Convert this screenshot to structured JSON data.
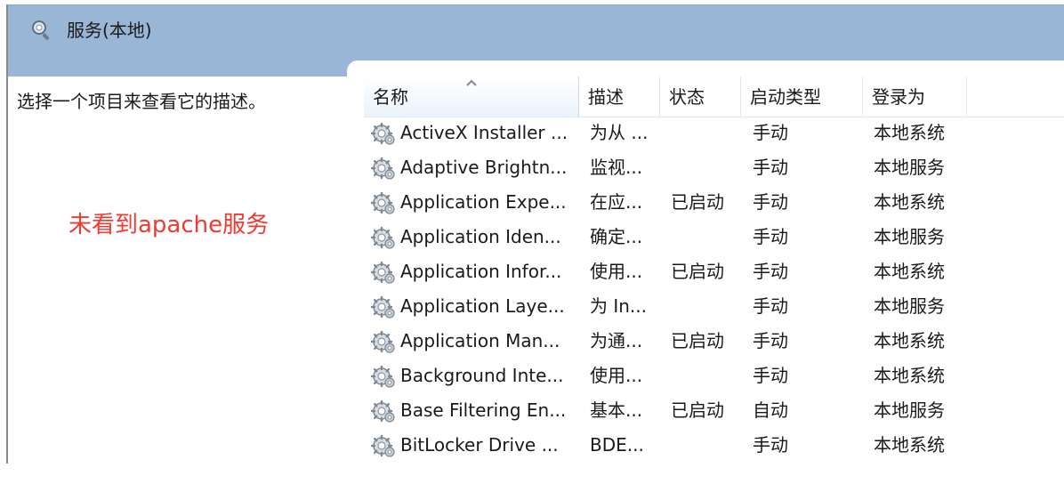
{
  "header": {
    "title": "服务(本地)"
  },
  "description_pane": {
    "text": "选择一个项目来查看它的描述。",
    "annotation": "未看到apache服务"
  },
  "columns": {
    "name": "名称",
    "desc": "描述",
    "status": "状态",
    "startup": "启动类型",
    "logon": "登录为"
  },
  "services": [
    {
      "name": "ActiveX Installer ...",
      "desc": "为从 ...",
      "status": "",
      "startup": "手动",
      "logon": "本地系统"
    },
    {
      "name": "Adaptive Brightn...",
      "desc": "监视...",
      "status": "",
      "startup": "手动",
      "logon": "本地服务"
    },
    {
      "name": "Application Expe...",
      "desc": "在应...",
      "status": "已启动",
      "startup": "手动",
      "logon": "本地系统"
    },
    {
      "name": "Application Iden...",
      "desc": "确定...",
      "status": "",
      "startup": "手动",
      "logon": "本地服务"
    },
    {
      "name": "Application Infor...",
      "desc": "使用...",
      "status": "已启动",
      "startup": "手动",
      "logon": "本地系统"
    },
    {
      "name": "Application Laye...",
      "desc": "为 In...",
      "status": "",
      "startup": "手动",
      "logon": "本地服务"
    },
    {
      "name": "Application Man...",
      "desc": "为通...",
      "status": "已启动",
      "startup": "手动",
      "logon": "本地系统"
    },
    {
      "name": "Background Inte...",
      "desc": "使用...",
      "status": "",
      "startup": "手动",
      "logon": "本地系统"
    },
    {
      "name": "Base Filtering En...",
      "desc": "基本...",
      "status": "已启动",
      "startup": "自动",
      "logon": "本地服务"
    },
    {
      "name": "BitLocker Drive ...",
      "desc": "BDE...",
      "status": "",
      "startup": "手动",
      "logon": "本地系统"
    }
  ]
}
